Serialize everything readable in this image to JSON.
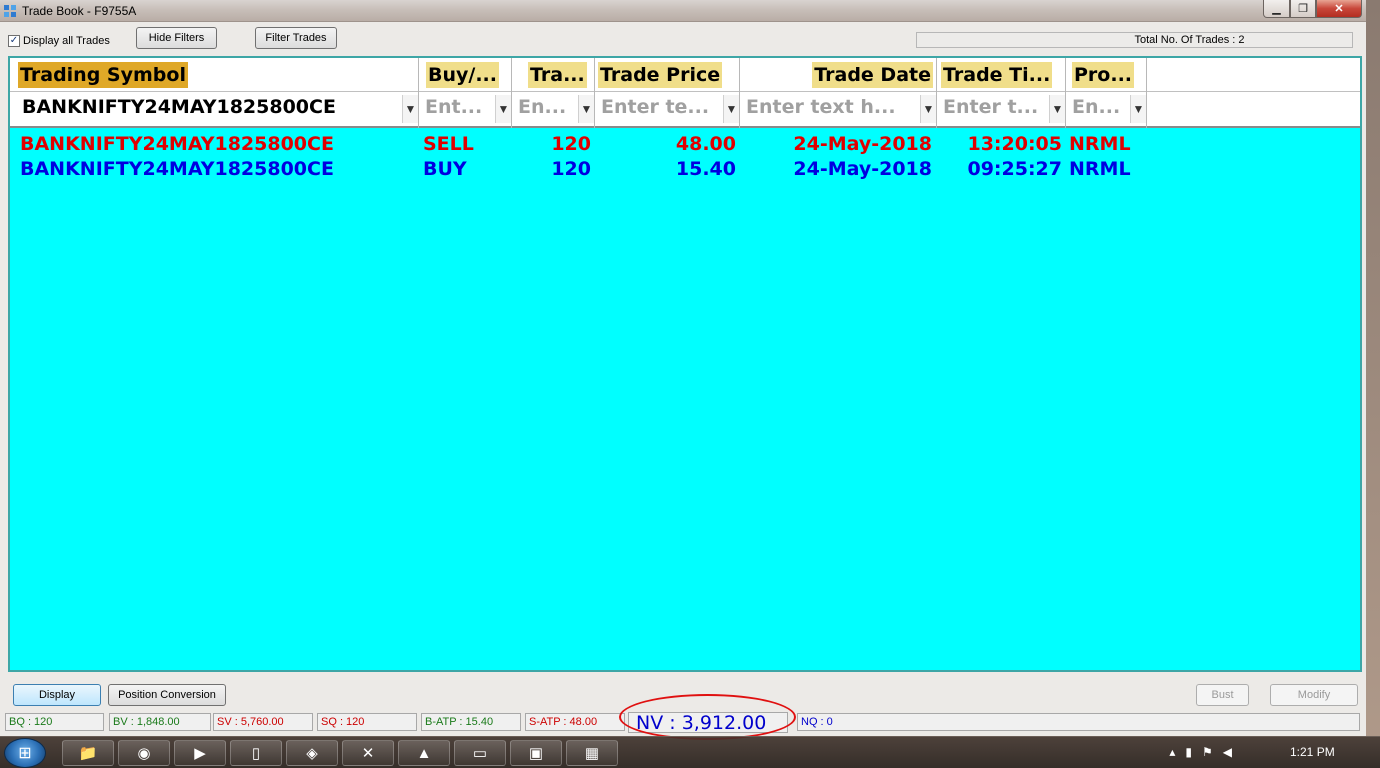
{
  "window": {
    "title": "Trade Book - F9755A"
  },
  "toolbar": {
    "display_all_label": "Display all Trades",
    "hide_filters": "Hide Filters",
    "filter_trades": "Filter Trades",
    "total_trades": "Total No. Of Trades : 2"
  },
  "columns": [
    {
      "header": "Trading Symbol",
      "filter": "BANKNIFTY24MAY1825800CE"
    },
    {
      "header": "Buy/...",
      "filter": "Ent..."
    },
    {
      "header": "Tra...",
      "filter": "En..."
    },
    {
      "header": "Trade Price",
      "filter": "Enter te..."
    },
    {
      "header": "Trade Date",
      "filter": "Enter text h..."
    },
    {
      "header": "Trade Ti...",
      "filter": "Enter t..."
    },
    {
      "header": "Pro...",
      "filter": "En..."
    }
  ],
  "rows": [
    {
      "symbol": "BANKNIFTY24MAY1825800CE",
      "side": "SELL",
      "qty": "120",
      "price": "48.00",
      "date": "24-May-2018",
      "time": "13:20:05",
      "product": "NRML",
      "color": "#e00000"
    },
    {
      "symbol": "BANKNIFTY24MAY1825800CE",
      "side": "BUY",
      "qty": "120",
      "price": "15.40",
      "date": "24-May-2018",
      "time": "09:25:27",
      "product": "NRML",
      "color": "#0000e0"
    }
  ],
  "bottom": {
    "display": "Display",
    "position_conversion": "Position Conversion",
    "bust": "Bust",
    "modify": "Modify"
  },
  "status": {
    "bq": "BQ : 120",
    "bv": "BV : 1,848.00",
    "sv": "SV : 5,760.00",
    "sq": "SQ : 120",
    "batp": "B-ATP : 15.40",
    "satp": "S-ATP : 48.00",
    "nv": "NV : 3,912.00",
    "nq": "NQ : 0"
  },
  "taskbar": {
    "clock": "1:21 PM"
  },
  "colors": {
    "grid_bg": "#00ffff",
    "sell": "#e00000",
    "buy": "#0000e0",
    "header_highlight": "#f0de8a"
  }
}
